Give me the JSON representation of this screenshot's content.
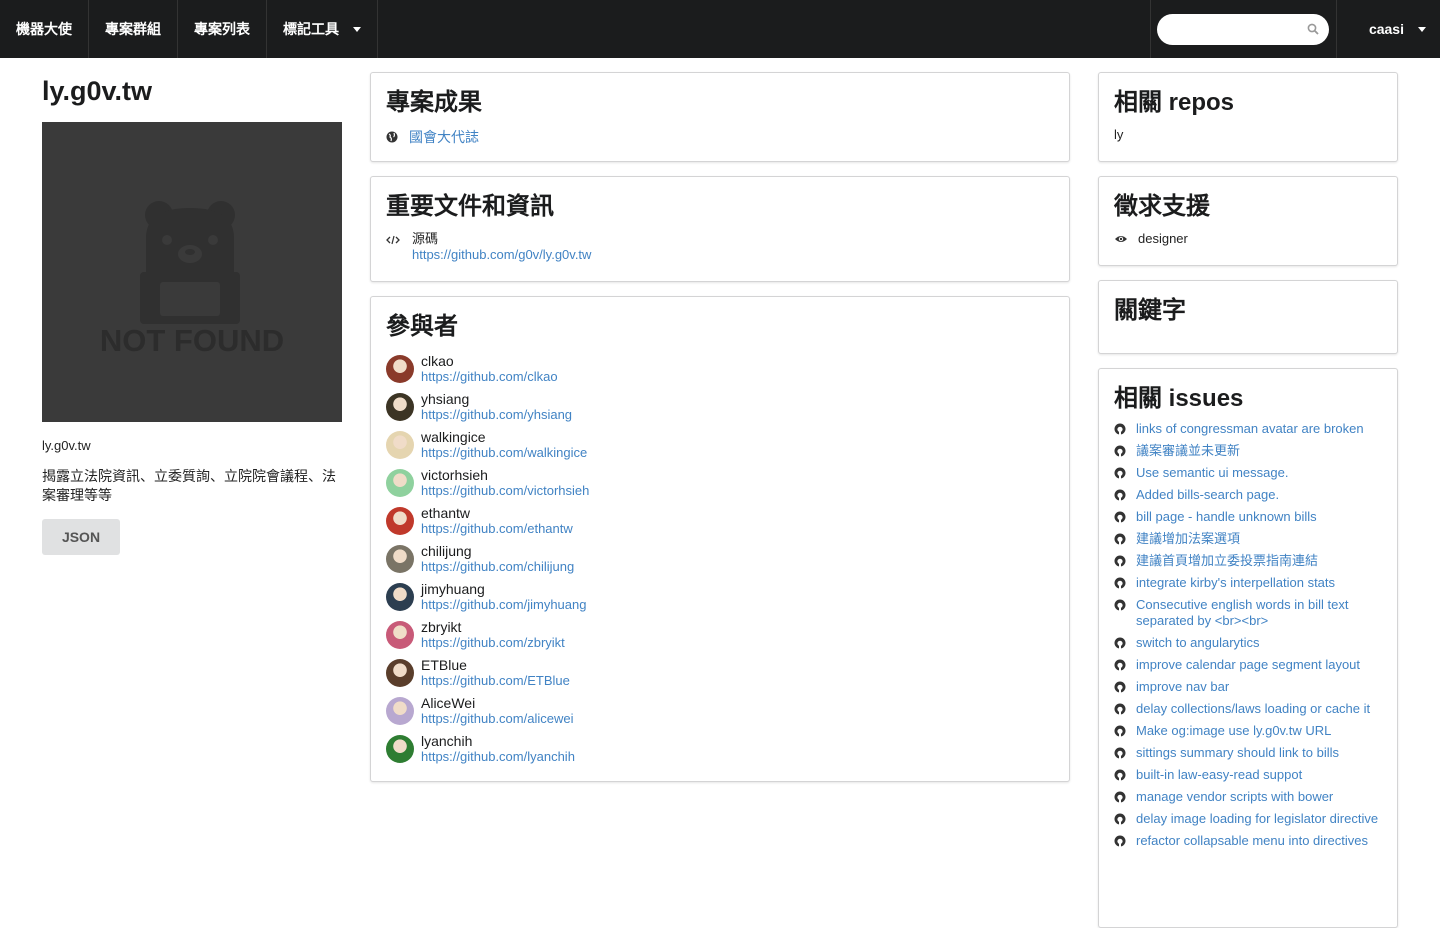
{
  "navbar": {
    "items": [
      {
        "label": "機器大使"
      },
      {
        "label": "專案群組"
      },
      {
        "label": "專案列表"
      },
      {
        "label": "標記工具"
      }
    ],
    "search": {
      "value": "",
      "placeholder": ""
    },
    "user": "caasi"
  },
  "project": {
    "title": "ly.g0v.tw",
    "thumb_text": "NOT FOUND",
    "caption": "ly.g0v.tw",
    "description": "揭露立法院資訊、立委質詢、立院院會議程、法案審理等等",
    "json_button": "JSON"
  },
  "results": {
    "heading": "專案成果",
    "items": [
      {
        "label": "國會大代誌",
        "icon": "globe-icon"
      }
    ]
  },
  "documents": {
    "heading": "重要文件和資訊",
    "items": [
      {
        "name": "源碼",
        "url": "https://github.com/g0v/ly.g0v.tw",
        "icon": "code-icon"
      }
    ]
  },
  "participants": {
    "heading": "參與者",
    "people": [
      {
        "name": "clkao",
        "url": "https://github.com/clkao",
        "color": "#8a3a2a"
      },
      {
        "name": "yhsiang",
        "url": "https://github.com/yhsiang",
        "color": "#3c3424"
      },
      {
        "name": "walkingice",
        "url": "https://github.com/walkingice",
        "color": "#e5d5b0"
      },
      {
        "name": "victorhsieh",
        "url": "https://github.com/victorhsieh",
        "color": "#8fd19e"
      },
      {
        "name": "ethantw",
        "url": "https://github.com/ethantw",
        "color": "#c0392b"
      },
      {
        "name": "chilijung",
        "url": "https://github.com/chilijung",
        "color": "#7a7466"
      },
      {
        "name": "jimyhuang",
        "url": "https://github.com/jimyhuang",
        "color": "#2c3e50"
      },
      {
        "name": "zbryikt",
        "url": "https://github.com/zbryikt",
        "color": "#c85a78"
      },
      {
        "name": "ETBlue",
        "url": "https://github.com/ETBlue",
        "color": "#5a3e2b"
      },
      {
        "name": "AliceWei",
        "url": "https://github.com/alicewei",
        "color": "#b8a8d0"
      },
      {
        "name": "lyanchih",
        "url": "https://github.com/lyanchih",
        "color": "#2e7d32"
      }
    ]
  },
  "repos": {
    "heading": "相關 repos",
    "items": [
      "ly"
    ]
  },
  "support": {
    "heading": "徵求支援",
    "items": [
      {
        "label": "designer",
        "icon": "eye-icon"
      }
    ]
  },
  "keywords": {
    "heading": "關鍵字"
  },
  "issues": {
    "heading": "相關 issues",
    "items": [
      "links of congressman avatar are broken",
      "議案審議並未更新",
      "Use semantic ui message.",
      "Added bills-search page.",
      "bill page - handle unknown bills",
      "建議增加法案選項",
      "建議首頁增加立委投票指南連結",
      "integrate kirby's interpellation stats",
      "Consecutive english words in bill text separated by <br><br>",
      "switch to angularytics",
      "improve calendar page segment layout",
      "improve nav bar",
      "delay collections/laws loading or cache it",
      "Make og:image use ly.g0v.tw URL",
      "sittings summary should link to bills",
      "built-in law-easy-read suppot",
      "manage vendor scripts with bower",
      "delay image loading for legislator directive",
      "refactor collapsable menu into directives"
    ]
  },
  "colors": {
    "navbar_bg": "#1b1c1d",
    "link": "#4183c4",
    "card_border": "#d4d4d5",
    "thumb_bg": "#3a3a3a"
  }
}
